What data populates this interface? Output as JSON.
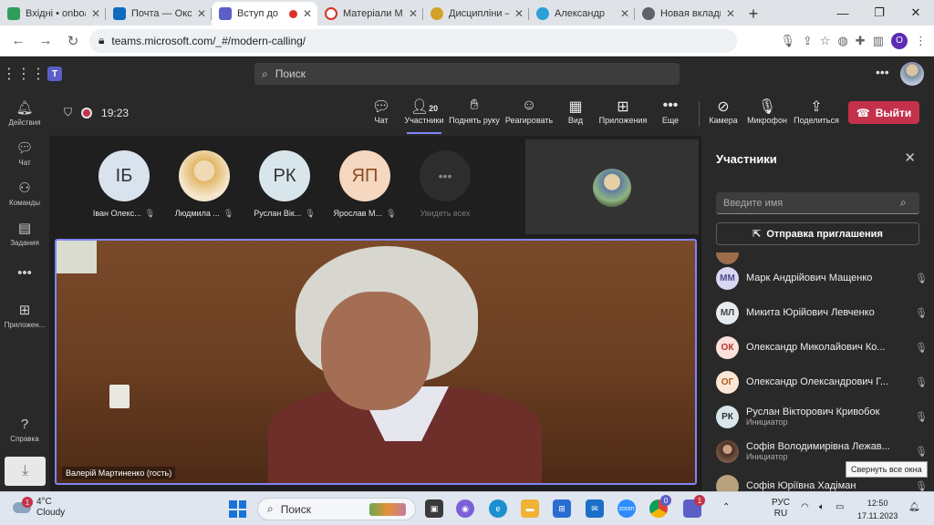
{
  "browser": {
    "tabs": [
      {
        "title": "Вхідні • onboard",
        "color": "#2e9e5a"
      },
      {
        "title": "Почта — Окс",
        "color": "#0f6cbd"
      },
      {
        "title": "Вступ до",
        "color": "#5b5fc7"
      },
      {
        "title": "Матеріали Мо",
        "color": "#d93025"
      },
      {
        "title": "Дисципліни –",
        "color": "#d4a22a"
      },
      {
        "title": "Александр",
        "color": "#2a9fd8"
      },
      {
        "title": "Новая вкладк",
        "color": "#5f6368"
      }
    ],
    "url": "teams.microsoft.com/_#/modern-calling/",
    "profile_letter": "O"
  },
  "teams": {
    "search_placeholder": "Поиск",
    "rail": [
      {
        "label": "Действия",
        "icon": "bell-icon"
      },
      {
        "label": "Чат",
        "icon": "chat-icon"
      },
      {
        "label": "Команды",
        "icon": "teams-icon"
      },
      {
        "label": "Задания",
        "icon": "assignments-icon"
      },
      {
        "label": "Приложен...",
        "icon": "apps-icon"
      },
      {
        "label": "Справка",
        "icon": "help-icon"
      }
    ]
  },
  "call": {
    "timer": "19:23",
    "participant_count": "20",
    "controls": [
      {
        "label": "Чат",
        "icon": "chat-icon"
      },
      {
        "label": "Участники",
        "icon": "people-icon"
      },
      {
        "label": "Поднять руку",
        "icon": "hand-icon"
      },
      {
        "label": "Реагировать",
        "icon": "smile-icon"
      },
      {
        "label": "Вид",
        "icon": "layout-icon"
      },
      {
        "label": "Приложения",
        "icon": "plus-icon"
      },
      {
        "label": "Еще",
        "icon": "more-icon"
      },
      {
        "label": "Камера",
        "icon": "camera-off-icon"
      },
      {
        "label": "Микрофон",
        "icon": "mic-off-icon"
      },
      {
        "label": "Поделиться",
        "icon": "share-icon"
      }
    ],
    "leave_label": "Выйти",
    "tiles": [
      {
        "initials": "ІБ",
        "name": "Іван Олекс...",
        "bg": "#d8e3ee",
        "fg": "#333333"
      },
      {
        "initials": "",
        "name": "Людмила ...",
        "bg": "#e8c58a",
        "fg": "#333333"
      },
      {
        "initials": "РК",
        "name": "Руслан Вік...",
        "bg": "#d8e6ec",
        "fg": "#333333"
      },
      {
        "initials": "ЯП",
        "name": "Ярослав М...",
        "bg": "#f6d7c0",
        "fg": "#8a4b23"
      }
    ],
    "see_all": "Увидеть всех",
    "main_caption": "Валерій Мартиненко (гость)"
  },
  "panel": {
    "title": "Участники",
    "name_placeholder": "Введите имя",
    "invite_label": "Отправка приглашения",
    "participants": [
      {
        "initials": "ММ",
        "name": "Марк Андрійович Мащенко",
        "role": "",
        "bg": "#d9d7f1",
        "fg": "#4f4b8f"
      },
      {
        "initials": "МЛ",
        "name": "Микита Юрійович Левченко",
        "role": "",
        "bg": "#e6ebf0",
        "fg": "#444444"
      },
      {
        "initials": "ОК",
        "name": "Олександр Миколайович Ко...",
        "role": "",
        "bg": "#fbe0dc",
        "fg": "#b3362a"
      },
      {
        "initials": "ОГ",
        "name": "Олександр Олександрович Г...",
        "role": "",
        "bg": "#fce7d6",
        "fg": "#b05a1a"
      },
      {
        "initials": "РК",
        "name": "Руслан Вікторович Кривобок",
        "role": "Инициатор",
        "bg": "#d8e6ec",
        "fg": "#333333"
      },
      {
        "initials": "",
        "name": "Софія Володимирівна Лежав...",
        "role": "Инициатор",
        "bg": "#6b4a3a",
        "fg": "#ffffff"
      },
      {
        "initials": "",
        "name": "Софія Юріївна Хадіман",
        "role": "",
        "bg": "#b8a27e",
        "fg": "#ffffff"
      }
    ],
    "tooltip": "Свернуть все окна"
  },
  "taskbar": {
    "temperature": "4°C",
    "weather": "Cloudy",
    "weather_badge": "1",
    "search_placeholder": "Поиск",
    "lang": "РУС",
    "lang2": "RU",
    "time": "12:50",
    "date": "17.11.2023",
    "teams_badge": "1",
    "chrome_badge": "0"
  }
}
